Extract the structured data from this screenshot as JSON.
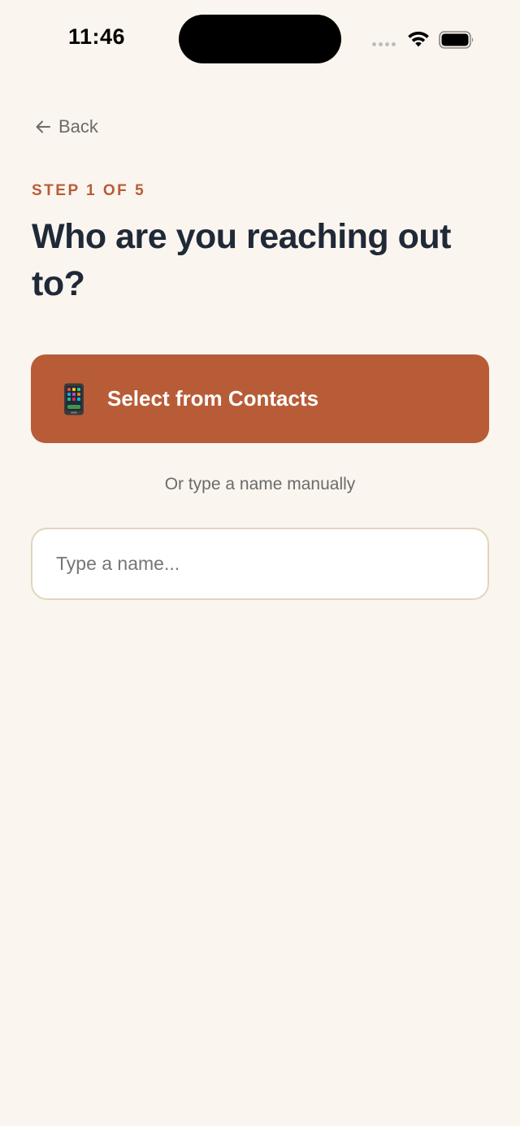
{
  "status_bar": {
    "time": "11:46",
    "icons": [
      "signal-dots-icon",
      "wifi-icon",
      "battery-icon"
    ]
  },
  "nav": {
    "back_label": "Back",
    "back_icon": "arrow-left-icon"
  },
  "step": {
    "label": "STEP 1 OF 5"
  },
  "title": "Who are you reaching out to?",
  "contacts_button": {
    "icon": "mobile-phone-icon",
    "label": "Select from Contacts"
  },
  "manual_hint": "Or type a name manually",
  "name_input": {
    "value": "",
    "placeholder": "Type a name..."
  },
  "colors": {
    "background": "#FAF5EE",
    "accent": "#B85C38",
    "title": "#1F2937",
    "muted_text": "#6B6B6B",
    "input_border": "#E0D5BE"
  }
}
